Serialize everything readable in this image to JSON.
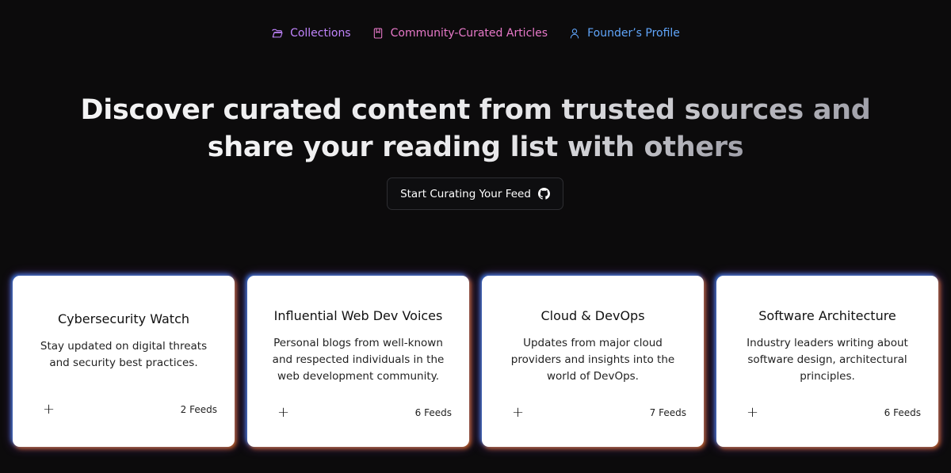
{
  "nav": {
    "items": [
      {
        "label": "Collections",
        "icon": "folder-open-icon",
        "color": "#c084fc"
      },
      {
        "label": "Community-Curated Articles",
        "icon": "bookmark-icon",
        "color": "#e879c9"
      },
      {
        "label": "Founder’s Profile",
        "icon": "user-icon",
        "color": "#60a5fa"
      }
    ]
  },
  "hero": {
    "line1": "Discover curated content from trusted sources and",
    "line2": "share your reading list with others",
    "cta_label": "Start Curating Your Feed",
    "cta_icon": "github-icon"
  },
  "cards": [
    {
      "title": "Cybersecurity Watch",
      "description": "Stay updated on digital threats and security best practices.",
      "feeds": "2 Feeds",
      "add": "+"
    },
    {
      "title": "Influential Web Dev Voices",
      "description": "Personal blogs from well-known and respected individuals in the web development community.",
      "feeds": "6 Feeds",
      "add": "+"
    },
    {
      "title": "Cloud & DevOps",
      "description": "Updates from major cloud providers and insights into the world of DevOps.",
      "feeds": "7 Feeds",
      "add": "+"
    },
    {
      "title": "Software Architecture",
      "description": "Industry leaders writing about software design, architectural principles.",
      "feeds": "6 Feeds",
      "add": "+"
    }
  ],
  "colors": {
    "background": "#0c0b0c",
    "glow_blue": "#3b82f6",
    "glow_orange": "#f97316"
  }
}
